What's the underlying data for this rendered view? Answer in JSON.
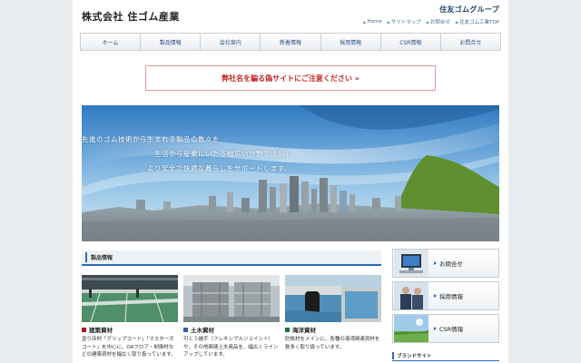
{
  "header": {
    "company_name": "株式会社 住ゴム産業",
    "group_logo": "住友ゴムグループ",
    "util_links": [
      {
        "label": "Home"
      },
      {
        "label": "サイトマップ"
      },
      {
        "label": "お問合せ"
      },
      {
        "label": "住友ゴム工業TOP"
      }
    ]
  },
  "gnav": {
    "items": [
      {
        "label": "ホーム"
      },
      {
        "label": "製品情報"
      },
      {
        "label": "会社案内"
      },
      {
        "label": "新着情報"
      },
      {
        "label": "採用情報"
      },
      {
        "label": "CSR情報"
      },
      {
        "label": "お問合せ"
      }
    ]
  },
  "warning": {
    "text": "弊社名を騙る偽サイトにご注意ください »",
    "color": "#c62828"
  },
  "hero": {
    "lines": [
      "先進のゴム技術から生まれる製品の数々を",
      "生活から産業にいたる幅広い分野で活用し",
      "より安全で快適な暮らしをサポートします。"
    ]
  },
  "products_section": {
    "title": "製品情報",
    "items": [
      {
        "title": "建築資材",
        "description": "塗り床材「グリップコート」「マスターズコート」を中心に、OAフロア・制振材などの建築資材を幅広く取り扱っています。",
        "icon": "building-floor-photo"
      },
      {
        "title": "土木資材",
        "description": "可とう継手（フレキシブルジョイント）や、その他関連土木商品を、幅広くラインアップしています。",
        "icon": "civil-engineering-photo"
      },
      {
        "title": "海洋資材",
        "description": "防舷材をメインに、各種の港湾関連資材を数多く取り扱っています。",
        "icon": "marine-fender-photo"
      }
    ]
  },
  "sidebar": {
    "buttons": [
      {
        "label": "お問合せ",
        "icon": "computer-icon"
      },
      {
        "label": "採用情報",
        "icon": "people-icon"
      },
      {
        "label": "CSR情報",
        "icon": "nature-icon"
      }
    ],
    "brand_site_title": "ブランドサイト"
  },
  "colors": {
    "accent": "#2f6cb3",
    "nav_text": "#2d5186",
    "warning": "#c62828"
  }
}
